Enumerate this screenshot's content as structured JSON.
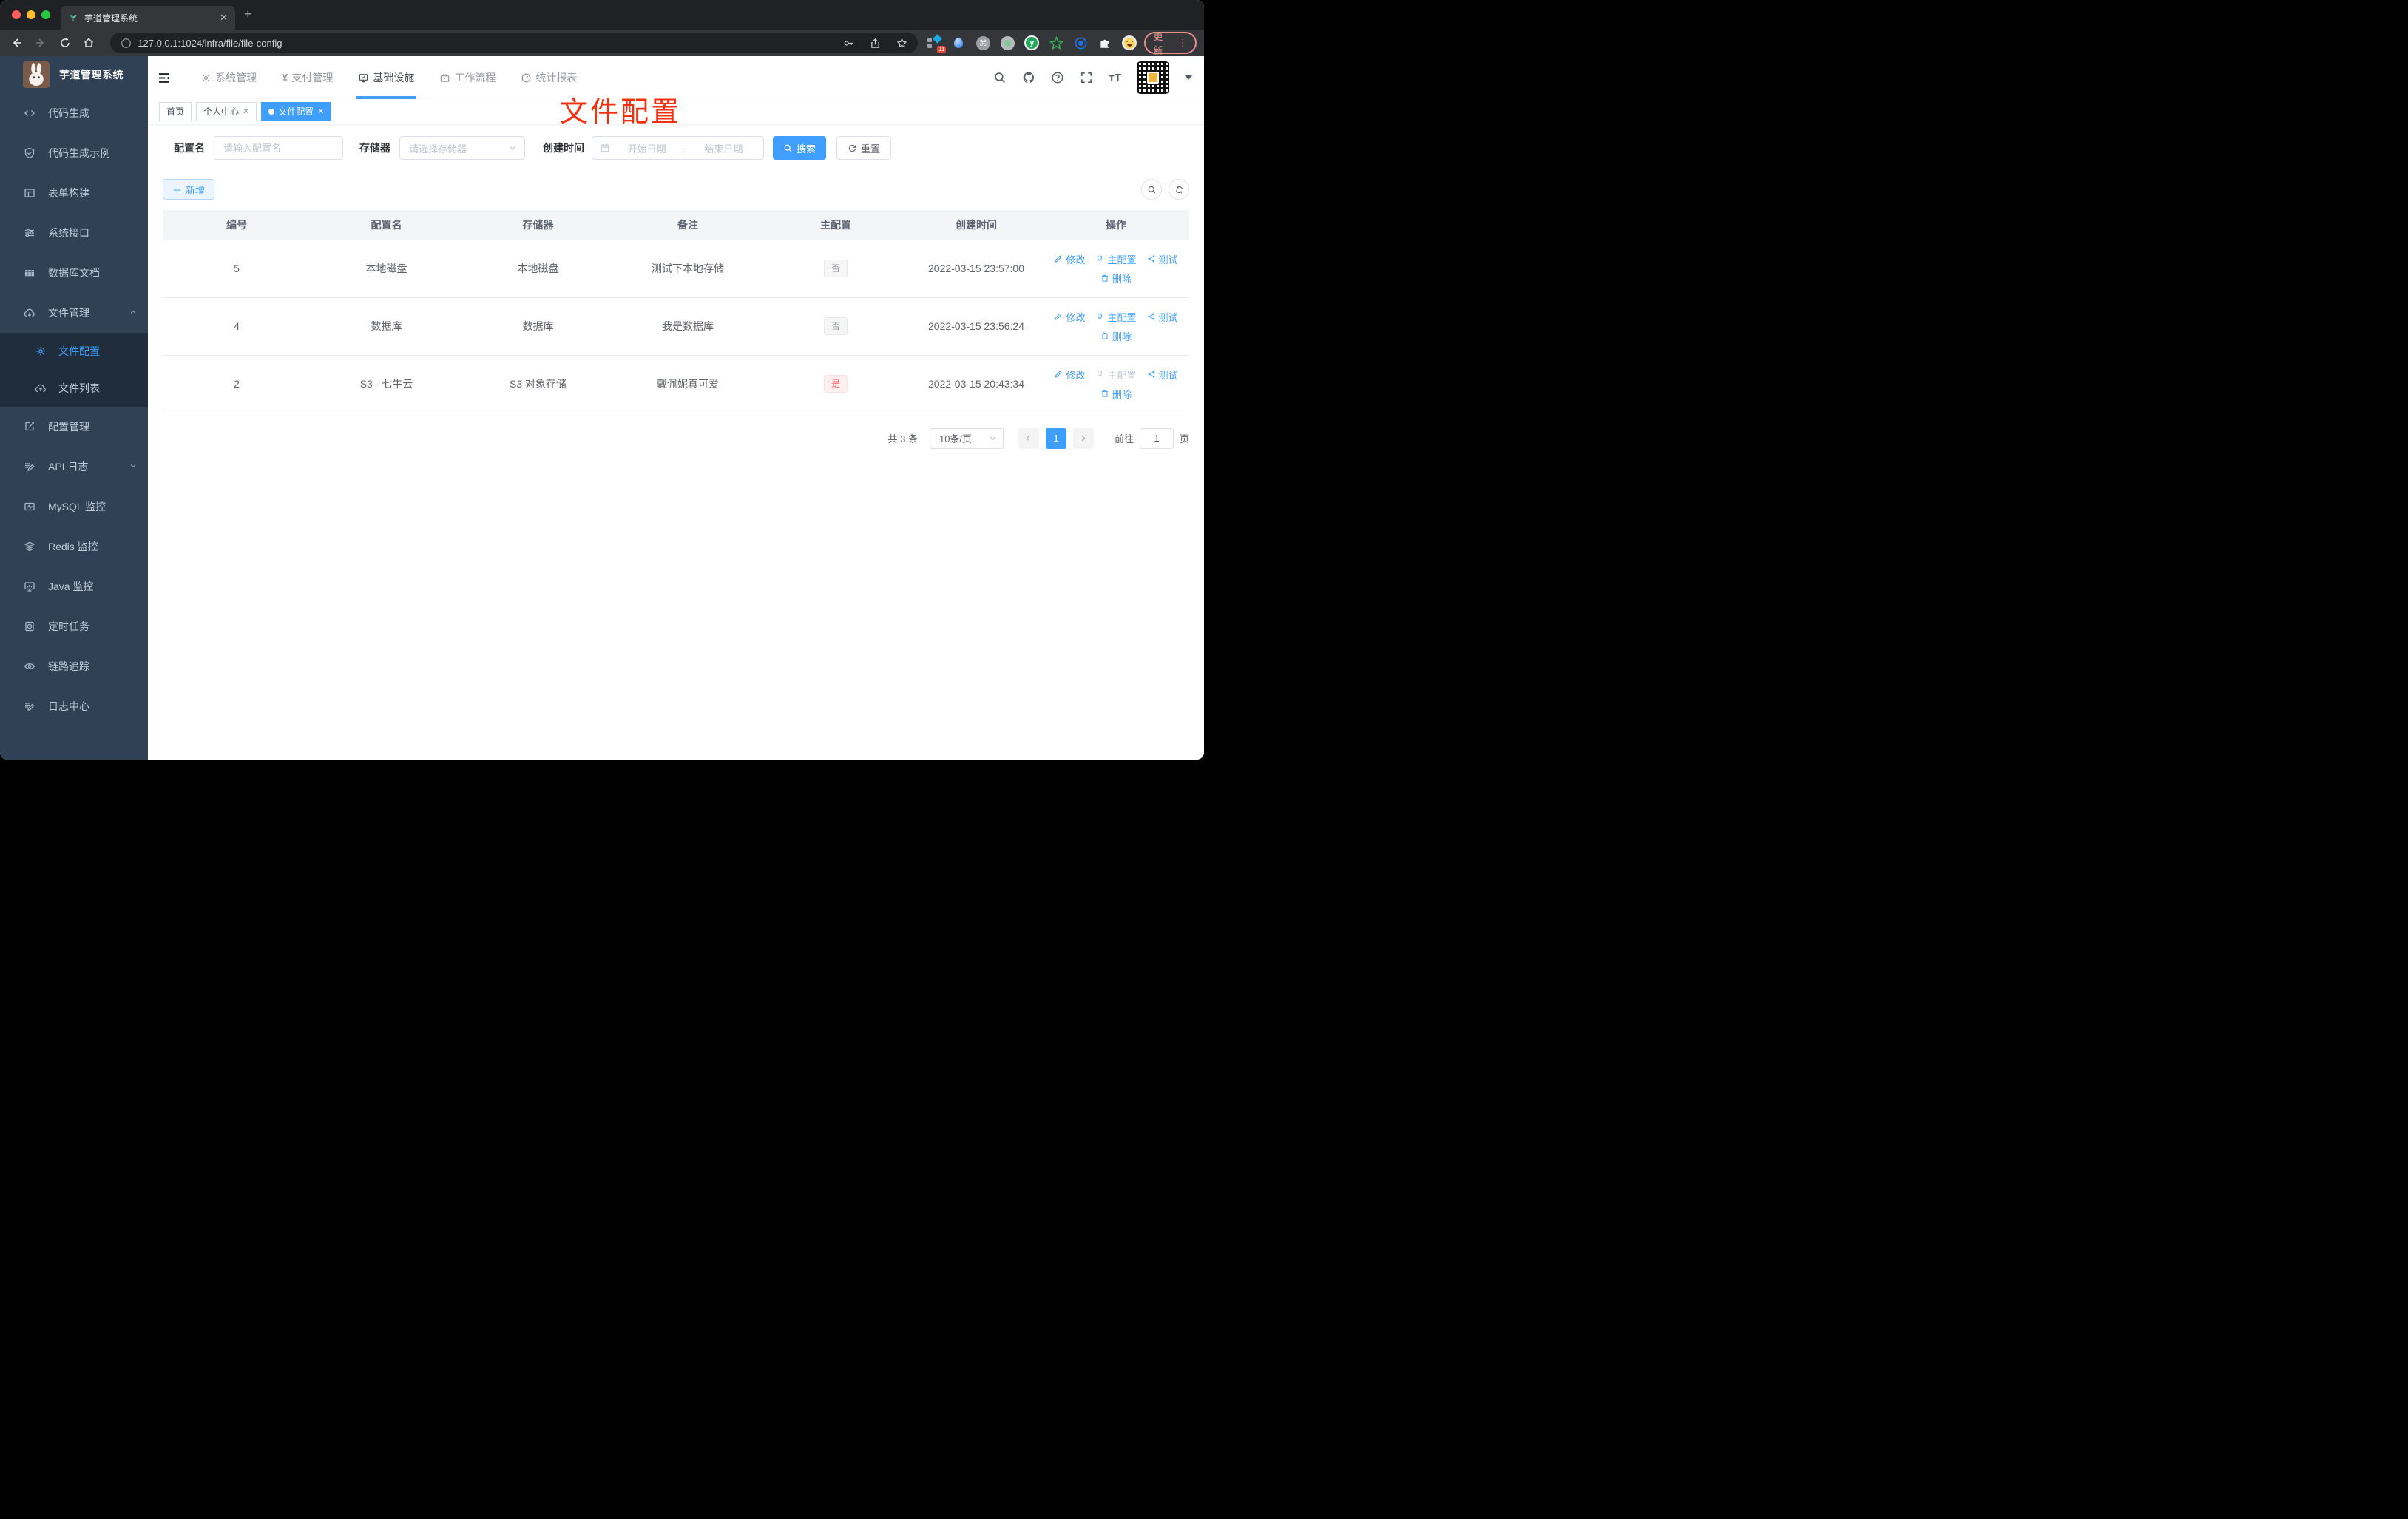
{
  "browser": {
    "tab_title": "芋道管理系统",
    "url": "127.0.0.1:1024/infra/file/file-config",
    "ext_badge": "11",
    "update_label": "更新",
    "menu_dots": "⋮"
  },
  "sidebar": {
    "brand": "芋道管理系统",
    "items": [
      {
        "label": "代码生成",
        "icon": "code-icon"
      },
      {
        "label": "代码生成示例",
        "icon": "shield-check-icon"
      },
      {
        "label": "表单构建",
        "icon": "form-icon"
      },
      {
        "label": "系统接口",
        "icon": "sliders-icon"
      },
      {
        "label": "数据库文档",
        "icon": "table-grid-icon"
      },
      {
        "label": "文件管理",
        "icon": "cloud-download-icon",
        "expanded": true
      },
      {
        "label": "文件配置",
        "icon": "gear-icon",
        "active": true,
        "sub": true
      },
      {
        "label": "文件列表",
        "icon": "cloud-upload-icon",
        "sub": true
      },
      {
        "label": "配置管理",
        "icon": "edit-square-icon"
      },
      {
        "label": "API 日志",
        "icon": "log-edit-icon",
        "collapsible": true
      },
      {
        "label": "MySQL 监控",
        "icon": "chart-pulse-icon"
      },
      {
        "label": "Redis 监控",
        "icon": "layers-icon"
      },
      {
        "label": "Java 监控",
        "icon": "monitor-icon"
      },
      {
        "label": "定时任务",
        "icon": "timer-icon"
      },
      {
        "label": "链路追踪",
        "icon": "eye-icon"
      },
      {
        "label": "日志中心",
        "icon": "log-edit-icon"
      }
    ]
  },
  "header": {
    "nav": [
      {
        "label": "系统管理",
        "icon": "gear-icon"
      },
      {
        "label": "支付管理",
        "icon": "yen-icon"
      },
      {
        "label": "基础设施",
        "icon": "infra-icon",
        "active": true
      },
      {
        "label": "工作流程",
        "icon": "briefcase-icon"
      },
      {
        "label": "统计报表",
        "icon": "gauge-icon"
      }
    ]
  },
  "tags": [
    {
      "label": "首页"
    },
    {
      "label": "个人中心",
      "closable": true
    },
    {
      "label": "文件配置",
      "closable": true,
      "active": true
    }
  ],
  "annotation": {
    "text": "文件配置",
    "color": "#f6300e"
  },
  "filter": {
    "name_label": "配置名",
    "name_placeholder": "请输入配置名",
    "storage_label": "存储器",
    "storage_placeholder": "请选择存储器",
    "date_label": "创建时间",
    "date_start_placeholder": "开始日期",
    "date_separator": "-",
    "date_end_placeholder": "结束日期",
    "search_label": "搜索",
    "reset_label": "重置"
  },
  "toolbar": {
    "add_label": "新增"
  },
  "table": {
    "headers": [
      "编号",
      "配置名",
      "存储器",
      "备注",
      "主配置",
      "创建时间",
      "操作"
    ],
    "rows": [
      {
        "id": "5",
        "name": "本地磁盘",
        "storage": "本地磁盘",
        "remark": "测试下本地存储",
        "master": "否",
        "time": "2022-03-15 23:57:00"
      },
      {
        "id": "4",
        "name": "数据库",
        "storage": "数据库",
        "remark": "我是数据库",
        "master": "否",
        "time": "2022-03-15 23:56:24"
      },
      {
        "id": "2",
        "name": "S3 - 七牛云",
        "storage": "S3 对象存储",
        "remark": "戴佩妮真可爱",
        "master": "是",
        "time": "2022-03-15 20:43:34"
      }
    ],
    "actions": {
      "edit": "修改",
      "master": "主配置",
      "test": "测试",
      "delete": "删除"
    }
  },
  "pagination": {
    "total": "共 3 条",
    "page_size": "10条/页",
    "current_page": "1",
    "goto_label": "前往",
    "goto_value": "1",
    "unit_label": "页"
  },
  "colors": {
    "accent": "#409eff",
    "sidebar_bg": "#304156",
    "submenu_bg": "#1f2d3d",
    "danger": "#f56c6c"
  }
}
